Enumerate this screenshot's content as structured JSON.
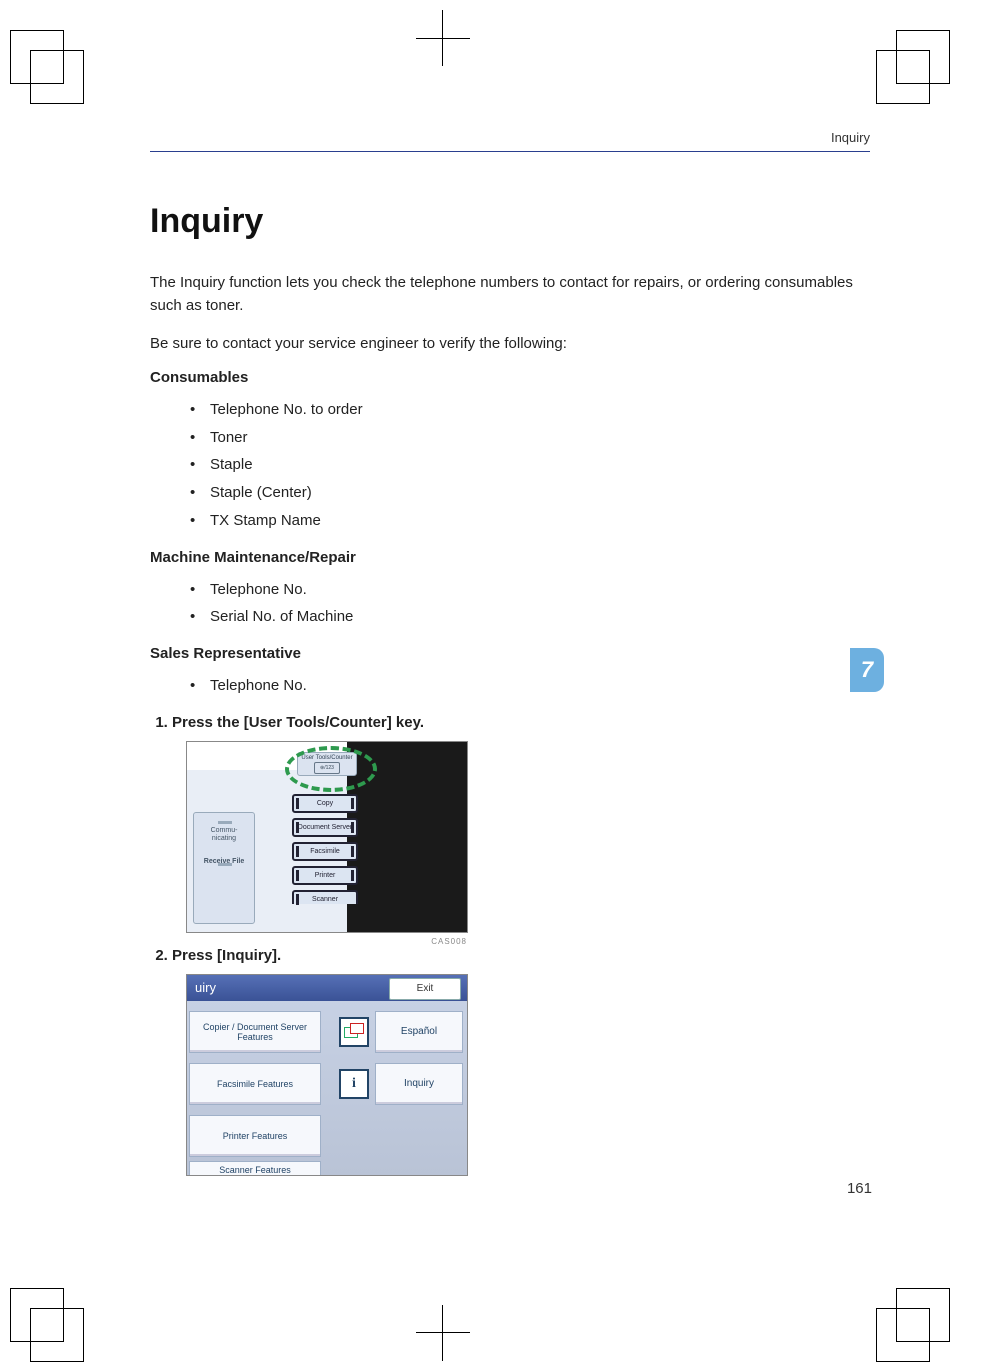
{
  "running_header": "Inquiry",
  "title": "Inquiry",
  "intro1": "The Inquiry function lets you check the telephone numbers to contact for repairs, or ordering consumables such as toner.",
  "intro2": "Be sure to contact your service engineer to verify the following:",
  "sections": {
    "consumables": {
      "heading": "Consumables",
      "items": [
        "Telephone No. to order",
        "Toner",
        "Staple",
        "Staple (Center)",
        "TX Stamp Name"
      ]
    },
    "maintenance": {
      "heading": "Machine Maintenance/Repair",
      "items": [
        "Telephone No.",
        "Serial No. of Machine"
      ]
    },
    "sales": {
      "heading": "Sales Representative",
      "items": [
        "Telephone No."
      ]
    }
  },
  "steps": {
    "s1": "Press the [User Tools/Counter] key.",
    "s2": "Press [Inquiry]."
  },
  "fig1": {
    "user_tools_label": "User Tools/Counter",
    "user_tools_icon": "⊛/123",
    "btn_copy": "Copy",
    "btn_doc": "Document Server",
    "btn_fax": "Facsimile",
    "btn_prn": "Printer",
    "btn_scn": "Scanner",
    "side_label1": "Commu-\nnicating",
    "side_label2": "Receive File",
    "caption": "CAS008"
  },
  "fig2": {
    "titlebar": "uiry",
    "exit": "Exit",
    "left1": "Copier / Document Server\nFeatures",
    "left2": "Facsimile Features",
    "left3": "Printer Features",
    "left4": "Scanner Features",
    "right1": "Español",
    "right2": "Inquiry",
    "info_icon": "i"
  },
  "section_number": "7",
  "page_number": "161"
}
